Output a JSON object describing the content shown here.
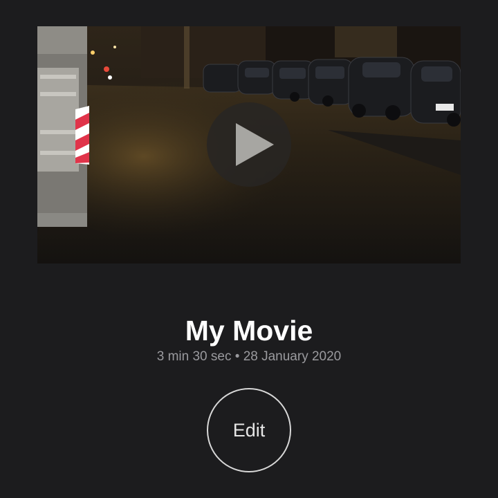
{
  "movie": {
    "title": "My Movie",
    "duration": "3 min 30 sec",
    "separator": "•",
    "date": "28 January 2020"
  },
  "actions": {
    "edit_label": "Edit",
    "play_icon": "play-icon"
  },
  "thumbnail": {
    "description_icon": "video-thumbnail"
  },
  "colors": {
    "background": "#1c1c1e",
    "title": "#ffffff",
    "meta": "#9a9a9e",
    "button_ring": "#d8d8d8"
  }
}
